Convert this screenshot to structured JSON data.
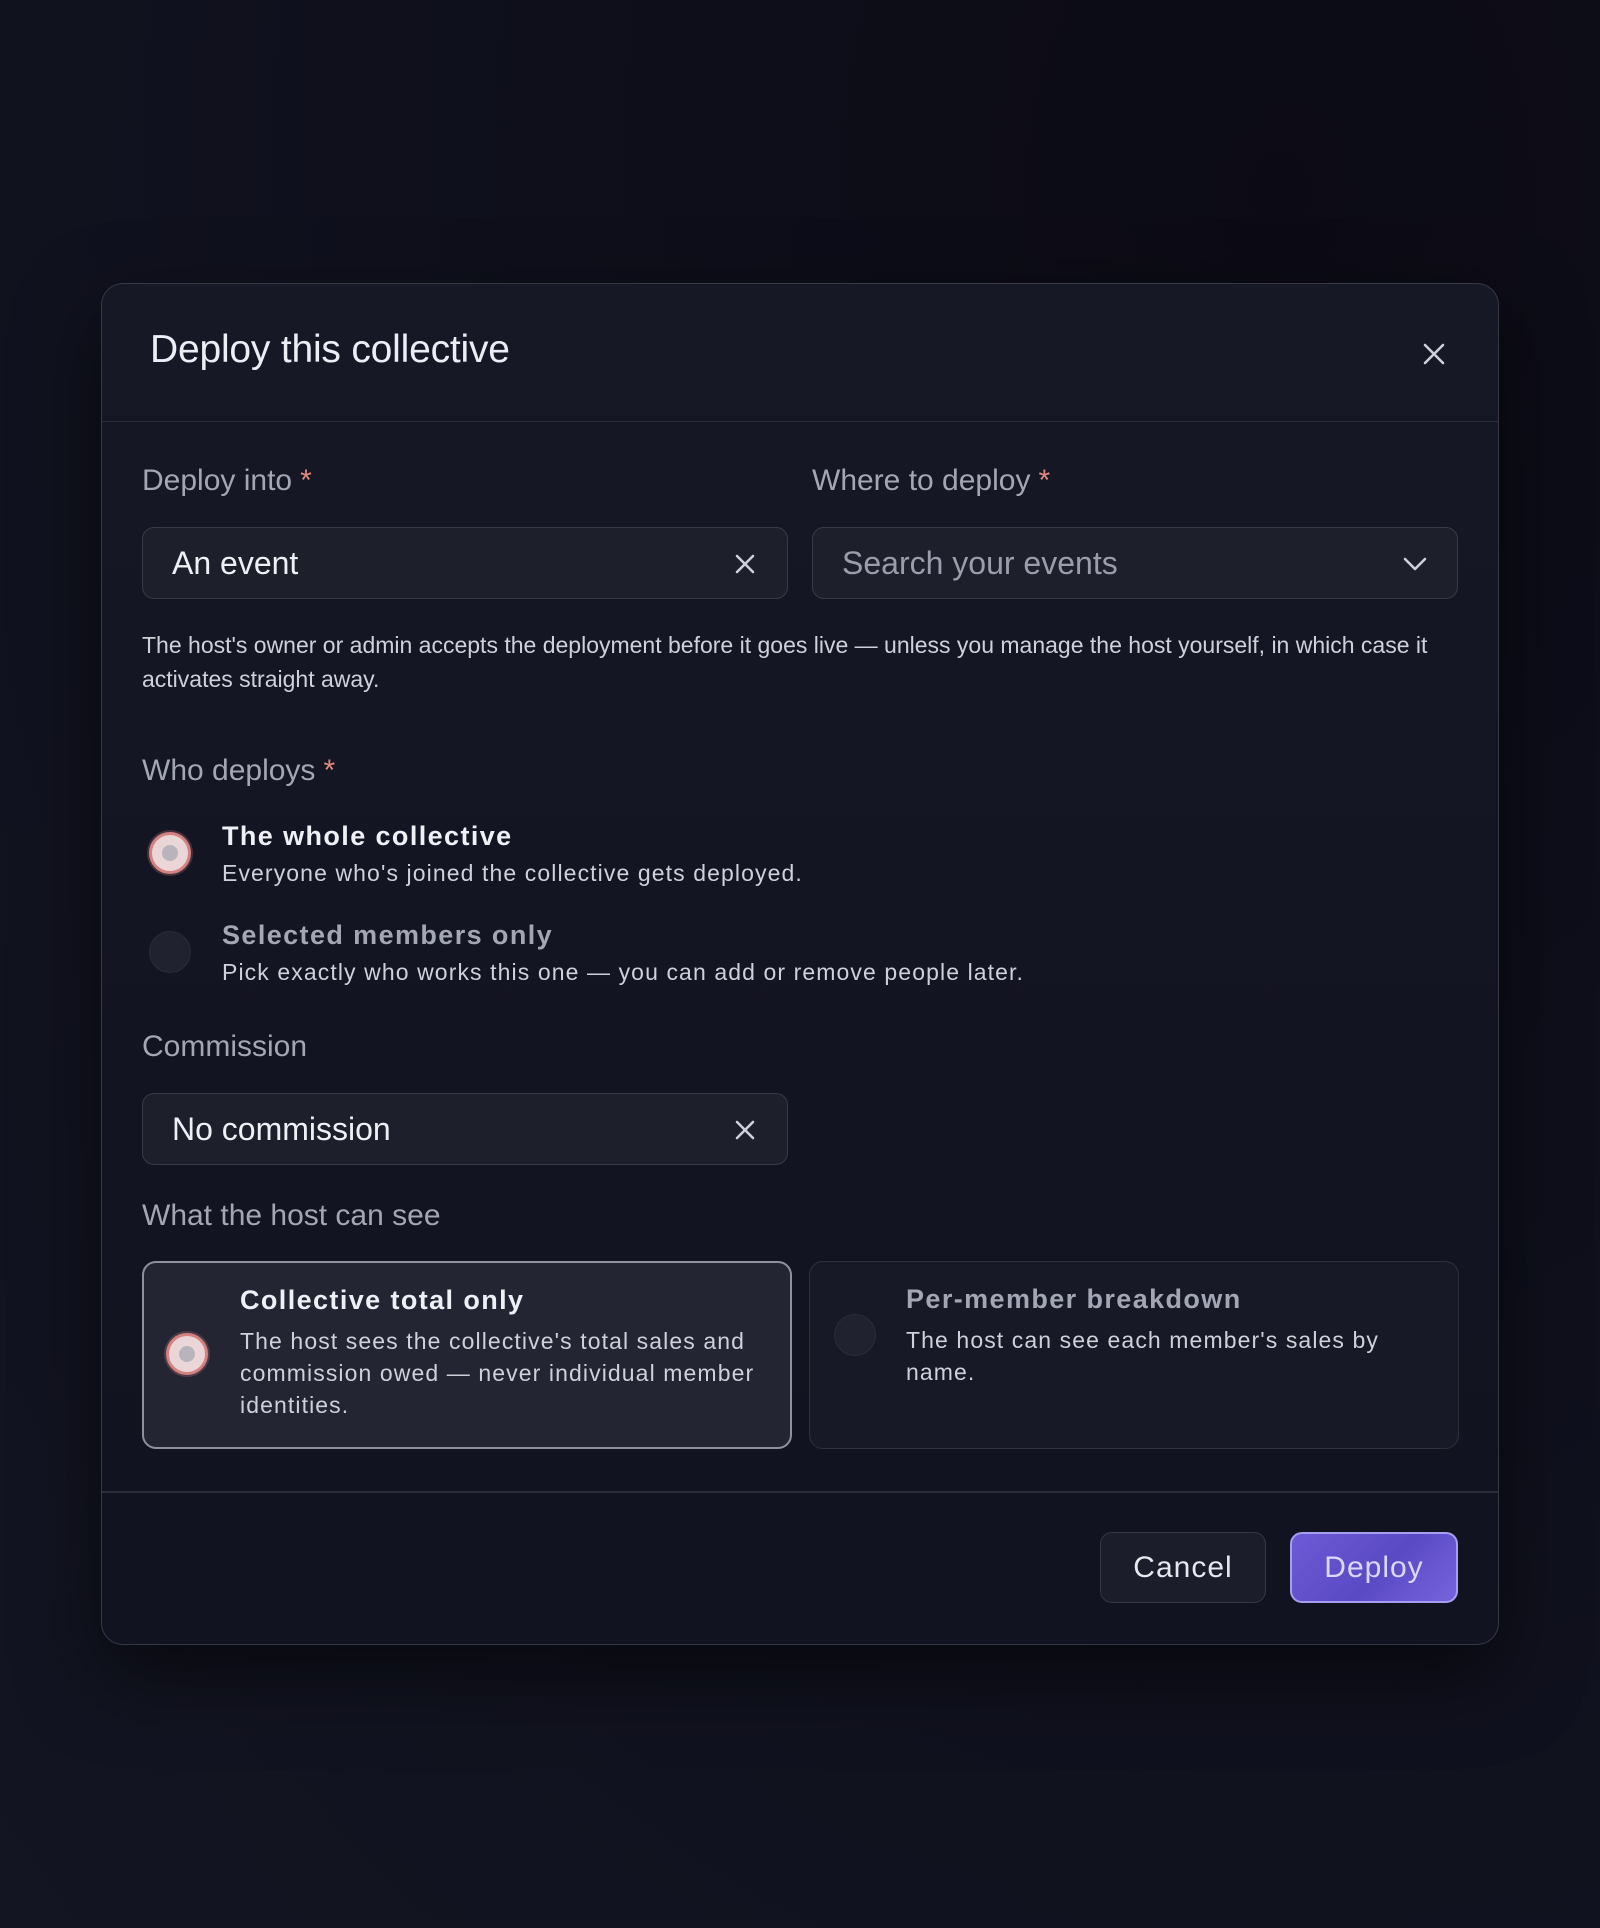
{
  "modal": {
    "title": "Deploy this collective"
  },
  "deploy_into": {
    "label": "Deploy into",
    "required_mark": "*",
    "value": "An event"
  },
  "where_to_deploy": {
    "label": "Where to deploy",
    "required_mark": "*",
    "placeholder": "Search your events"
  },
  "help_text": "The host's owner or admin accepts the deployment before it goes live — unless you manage the host yourself, in which case it activates straight away.",
  "who_deploys": {
    "label": "Who deploys",
    "required_mark": "*",
    "options": [
      {
        "title": "The whole collective",
        "description": "Everyone who's joined the collective gets deployed.",
        "selected": true
      },
      {
        "title": "Selected members only",
        "description": "Pick exactly who works this one — you can add or remove people later.",
        "selected": false
      }
    ]
  },
  "commission": {
    "label": "Commission",
    "value": "No commission"
  },
  "visibility": {
    "label": "What the host can see",
    "options": [
      {
        "title": "Collective total only",
        "description": "The host sees the collective's total sales and commission owed — never individual member identities.",
        "selected": true
      },
      {
        "title": "Per-member breakdown",
        "description": "The host can see each member's sales by name.",
        "selected": false
      }
    ]
  },
  "footer": {
    "cancel_label": "Cancel",
    "deploy_label": "Deploy"
  },
  "colors": {
    "accent": "#6e5ad6",
    "required": "#e08a7e",
    "radio_selected": "#d48181"
  },
  "icons": {
    "close": "close-icon",
    "clear": "clear-icon",
    "dropdown": "chevron-down-icon"
  }
}
